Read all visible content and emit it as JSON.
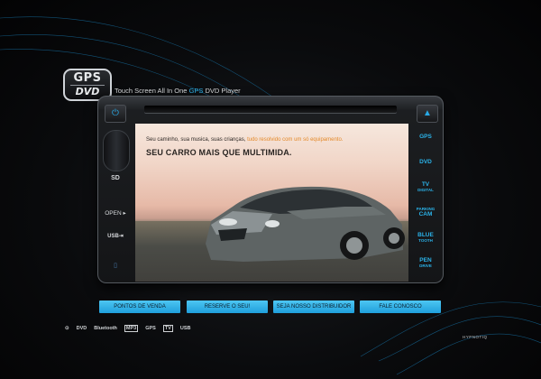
{
  "brand": {
    "logo_line1": "GPS",
    "logo_line2": "DVD"
  },
  "tagline": {
    "before": "Touch Screen All In One ",
    "accent": "GPS",
    "after": " DVD Player"
  },
  "controls": {
    "power_symbol": "⏻",
    "eject_symbol": "▲",
    "left": {
      "sd": "SD",
      "open": "OPEN ▸",
      "usb": "USB⇥",
      "mini": "▯"
    },
    "right": [
      {
        "main": "GPS",
        "sub": ""
      },
      {
        "main": "DVD",
        "sub": ""
      },
      {
        "main": "TV",
        "sub": "DIGITAL"
      },
      {
        "main": "PARKING",
        "sub": "CAM"
      },
      {
        "main": "BLUE",
        "sub": "TOOTH"
      },
      {
        "main": "PEN",
        "sub": "DRIVE"
      }
    ]
  },
  "screen": {
    "line1_before": "Seu caminho, sua musica, suas crianças, ",
    "line1_accent": "tudo resolvido com um só equipamento.",
    "line2": "SEU CARRO MAIS QUE MULTIMIDA."
  },
  "nav": [
    "PONTOS DE VENDA",
    "RESERVE O SEU!",
    "SEJA NOSSO DISTRIBUIDOR",
    "FALE CONOSCO"
  ],
  "footer_logos": [
    "⊙",
    "DVD",
    "Bluetooth",
    "MP3",
    "GPS",
    "TV",
    "USB"
  ],
  "credit": "HYPNOTIQ",
  "colors": {
    "accent": "#31b6ec",
    "orange_text": "#e48a2a",
    "nav_button": "#31b4ec"
  }
}
